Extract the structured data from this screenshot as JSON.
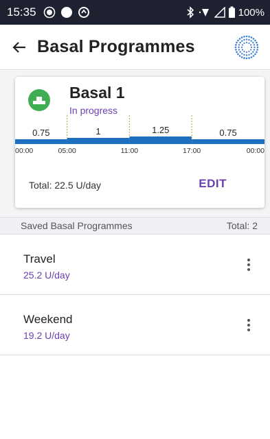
{
  "status_bar": {
    "time": "15:35",
    "battery": "100%",
    "icons": [
      "record-icon",
      "circle-icon",
      "data-saver-icon",
      "bluetooth-icon",
      "wifi-icon",
      "signal-icon",
      "battery-icon"
    ]
  },
  "header": {
    "title": "Basal Programmes",
    "back_icon": "arrow-left-icon",
    "pod_icon": "pod-status-icon"
  },
  "active_program": {
    "name": "Basal 1",
    "status": "In progress",
    "total": "Total: 22.5 U/day",
    "edit_label": "EDIT",
    "icon": "basal-program-icon"
  },
  "chart_data": {
    "type": "step",
    "x_ticks": [
      "00:00",
      "05:00",
      "11:00",
      "17:00",
      "00:00"
    ],
    "segments": [
      {
        "start": "00:00",
        "end": "05:00",
        "rate": 0.75,
        "label": "0.75"
      },
      {
        "start": "05:00",
        "end": "11:00",
        "rate": 1,
        "label": "1"
      },
      {
        "start": "11:00",
        "end": "17:00",
        "rate": 1.25,
        "label": "1.25"
      },
      {
        "start": "17:00",
        "end": "00:00",
        "rate": 0.75,
        "label": "0.75"
      }
    ],
    "bar_color": "#1f6fc0"
  },
  "saved_section": {
    "title": "Saved Basal Programmes",
    "count": "Total: 2"
  },
  "saved_programs": [
    {
      "name": "Travel",
      "rate": "25.2 U/day"
    },
    {
      "name": "Weekend",
      "rate": "19.2 U/day"
    }
  ],
  "colors": {
    "accent": "#6a3fb0",
    "status_bar": "#1e2230",
    "program_icon": "#3fae52"
  }
}
